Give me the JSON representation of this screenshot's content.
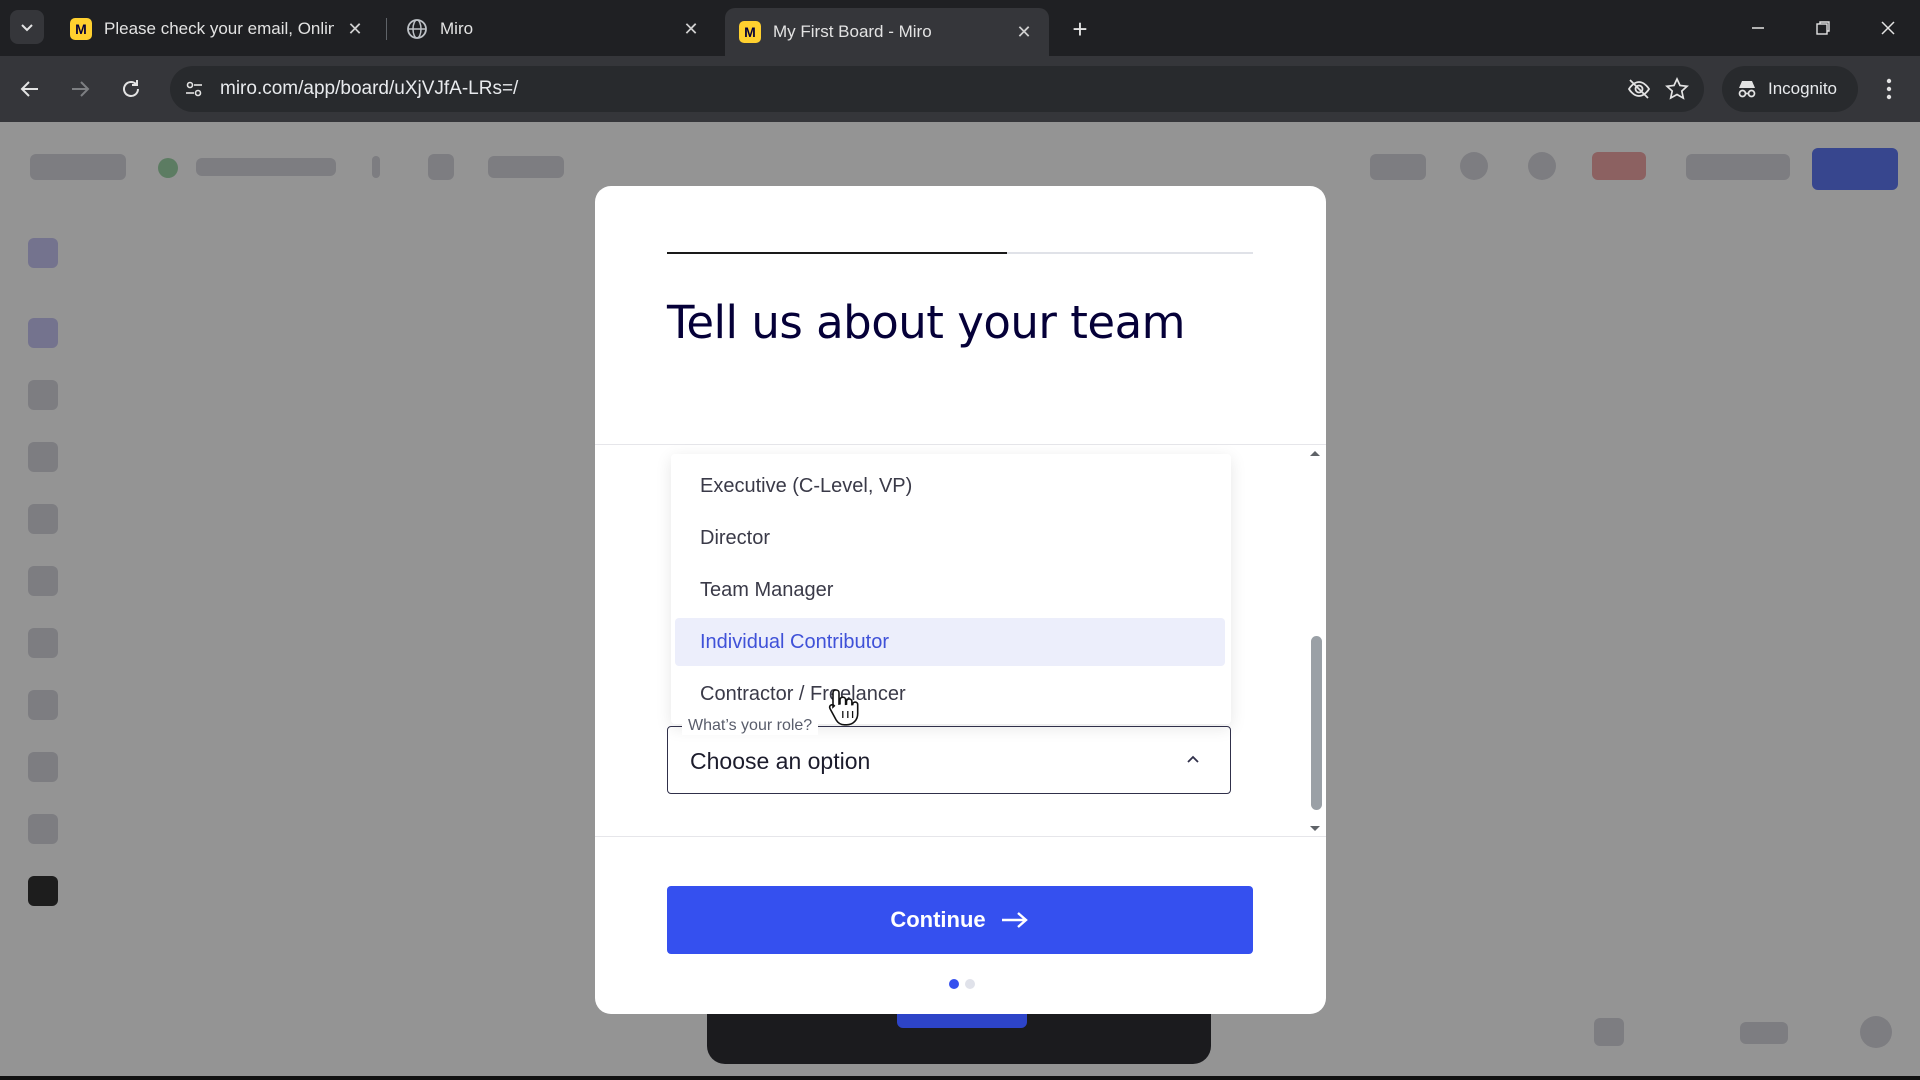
{
  "browser": {
    "tabs": [
      {
        "title": "Please check your email, Online",
        "favicon": "miro-logo-icon",
        "active": false
      },
      {
        "title": "Miro",
        "favicon": "globe-icon",
        "active": false
      },
      {
        "title": "My First Board - Miro",
        "favicon": "miro-logo-icon",
        "active": true
      }
    ],
    "favicon_letter": "M",
    "url": "miro.com/app/board/uXjVJfA-LRs=/",
    "profile_label": "Incognito",
    "colors": {
      "tabstrip": "#1f2023",
      "toolbar": "#35363a",
      "omnibox": "#282a2d"
    }
  },
  "modal": {
    "title": "Tell us about your team",
    "progress": 0.58,
    "role_field": {
      "label": "What’s your role?",
      "value": "Choose an option",
      "expanded": true,
      "options": [
        {
          "label": "Executive (C-Level, VP)",
          "hovered": false
        },
        {
          "label": "Director",
          "hovered": false
        },
        {
          "label": "Team Manager",
          "hovered": false
        },
        {
          "label": "Individual Contributor",
          "hovered": true
        },
        {
          "label": "Contractor / Freelancer",
          "hovered": false
        }
      ]
    },
    "continue_label": "Continue",
    "steps": {
      "total": 2,
      "current": 1
    },
    "colors": {
      "primary": "#3550ef",
      "title": "#050038",
      "hover_bg": "#eceefb",
      "hover_text": "#3f51d8"
    }
  }
}
